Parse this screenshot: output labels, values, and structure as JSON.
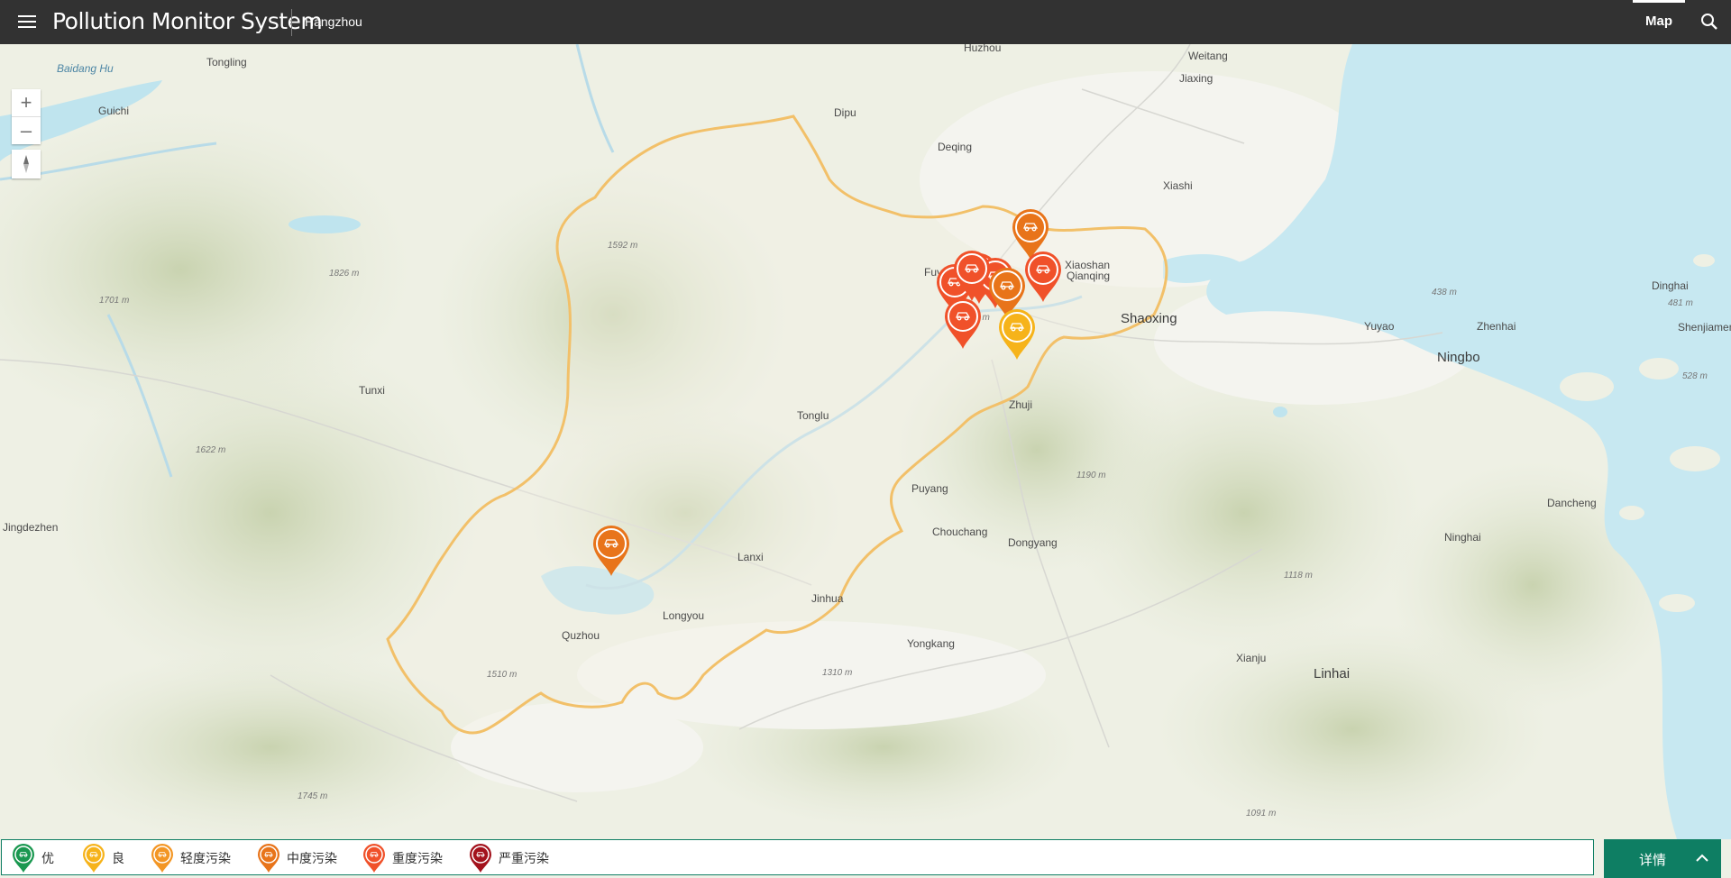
{
  "header": {
    "title": "Pollution Monitor System",
    "city": "Hangzhou",
    "nav_tab": "Map"
  },
  "map": {
    "zoom_in": "+",
    "zoom_out": "–",
    "places": [
      {
        "name": "Huzhou",
        "big": false
      },
      {
        "name": "Weitang",
        "big": false
      },
      {
        "name": "Jiaxing",
        "big": false
      },
      {
        "name": "Tongling",
        "big": false
      },
      {
        "name": "Baidang Hu",
        "big": false
      },
      {
        "name": "Guichi",
        "big": false
      },
      {
        "name": "Dipu",
        "big": false
      },
      {
        "name": "Deqing",
        "big": false
      },
      {
        "name": "Xiashi",
        "big": false
      },
      {
        "name": "Fuyang",
        "big": false
      },
      {
        "name": "Xiaoshan",
        "big": false
      },
      {
        "name": "Qianqing",
        "big": false
      },
      {
        "name": "Shaoxing",
        "big": true
      },
      {
        "name": "Yuyao",
        "big": false
      },
      {
        "name": "Zhenhai",
        "big": false
      },
      {
        "name": "Dinghai",
        "big": false
      },
      {
        "name": "Shenjiamen",
        "big": false
      },
      {
        "name": "Ningbo",
        "big": true
      },
      {
        "name": "Tunxi",
        "big": false
      },
      {
        "name": "Tonglu",
        "big": false
      },
      {
        "name": "Zhuji",
        "big": false
      },
      {
        "name": "Puyang",
        "big": false
      },
      {
        "name": "Jingdezhen",
        "big": false
      },
      {
        "name": "Chouchang",
        "big": false
      },
      {
        "name": "Dongyang",
        "big": false
      },
      {
        "name": "Dancheng",
        "big": false
      },
      {
        "name": "Ninghai",
        "big": false
      },
      {
        "name": "Lanxi",
        "big": false
      },
      {
        "name": "Jinhua",
        "big": false
      },
      {
        "name": "Longyou",
        "big": false
      },
      {
        "name": "Quzhou",
        "big": false
      },
      {
        "name": "Yongkang",
        "big": false
      },
      {
        "name": "Xianju",
        "big": false
      },
      {
        "name": "Linhai",
        "big": true
      }
    ],
    "elevations": [
      "1592 m",
      "1826 m",
      "1701 m",
      "1622 m",
      "785 m",
      "438 m",
      "481 m",
      "528 m",
      "1190 m",
      "1510 m",
      "1310 m",
      "1118 m",
      "1745 m",
      "1091 m"
    ],
    "markers": [
      {
        "level": "moderate",
        "color": "#e8741a"
      },
      {
        "level": "heavy",
        "color": "#f0512a"
      },
      {
        "level": "heavy",
        "color": "#f0512a"
      },
      {
        "level": "heavy",
        "color": "#f0512a"
      },
      {
        "level": "moderate",
        "color": "#e8741a"
      },
      {
        "level": "heavy",
        "color": "#f0512a"
      },
      {
        "level": "heavy",
        "color": "#f0512a"
      },
      {
        "level": "heavy",
        "color": "#f0512a"
      },
      {
        "level": "good",
        "color": "#f6b31a"
      }
    ]
  },
  "legend": {
    "items": [
      {
        "label": "优",
        "color": "#1a9850"
      },
      {
        "label": "良",
        "color": "#f6b31a"
      },
      {
        "label": "轻度污染",
        "color": "#f39624"
      },
      {
        "label": "中度污染",
        "color": "#e8741a"
      },
      {
        "label": "重度污染",
        "color": "#f0512a"
      },
      {
        "label": "严重污染",
        "color": "#a3121c"
      }
    ]
  },
  "details": {
    "label": "详情"
  },
  "colors": {
    "header_bg": "#323232",
    "accent": "#0e7e63",
    "water": "#bfe4ee",
    "boundary": "#f3c274"
  }
}
